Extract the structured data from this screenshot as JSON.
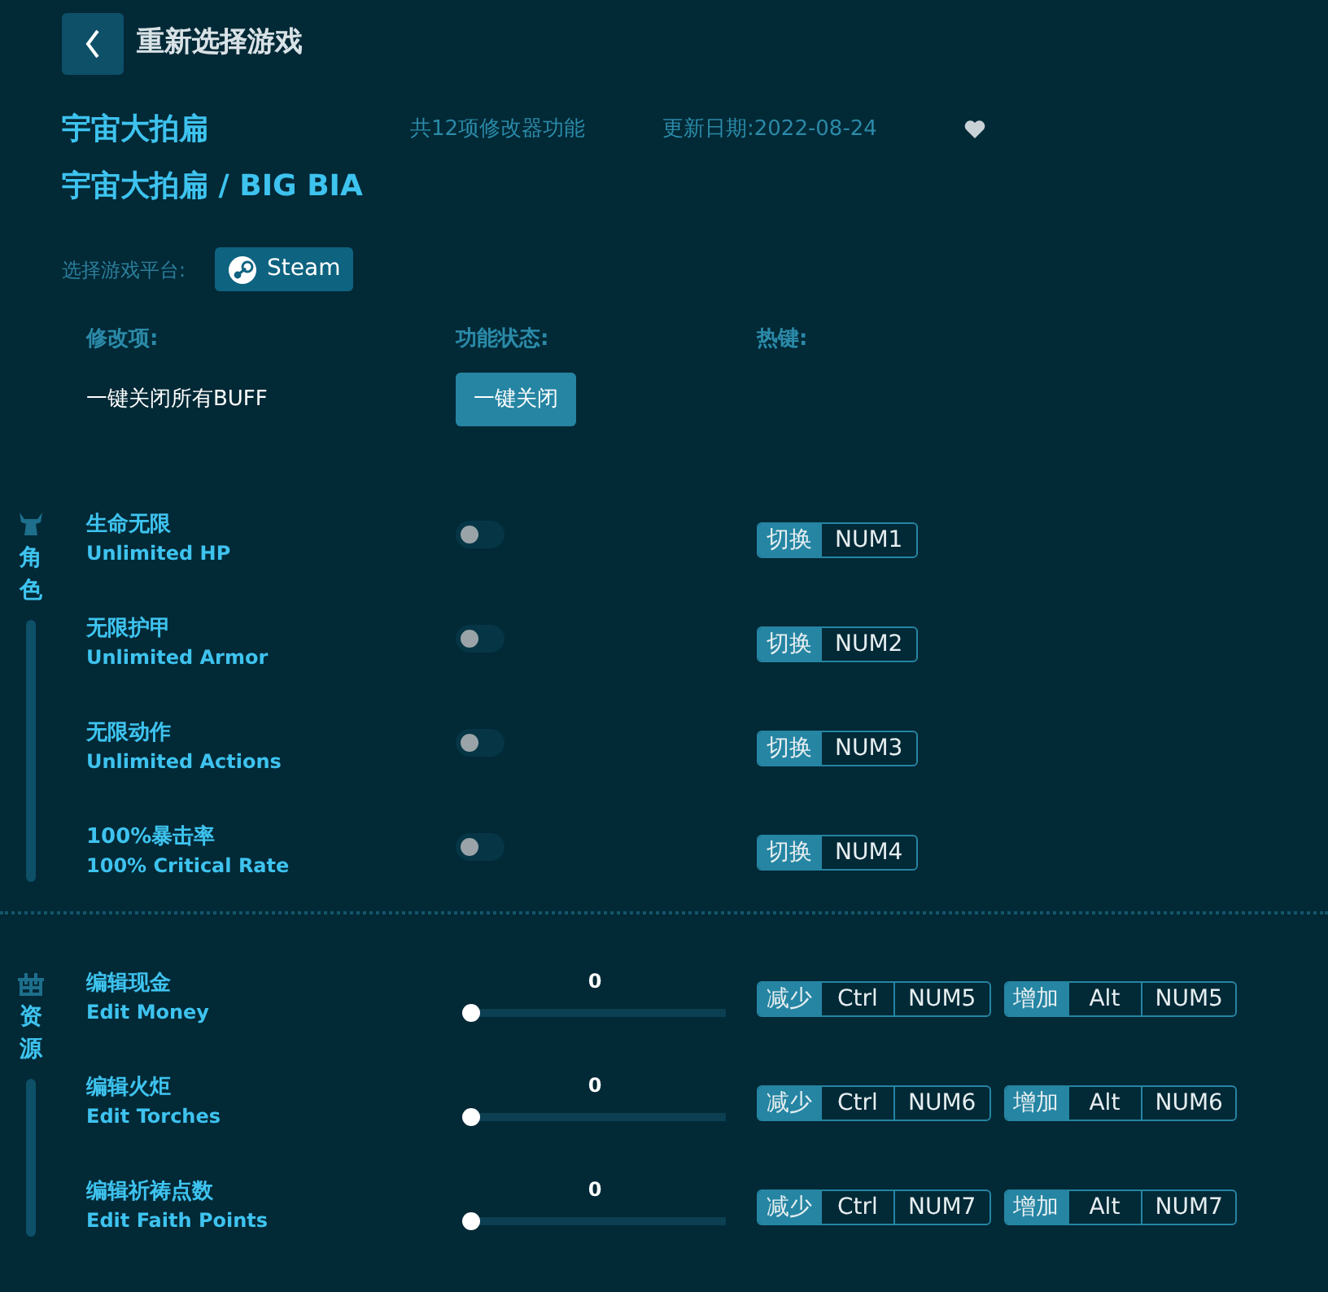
{
  "header": {
    "back_label": "重新选择游戏"
  },
  "game": {
    "title": "宇宙大拍扁",
    "feature_count": "共12项修改器功能",
    "update_date": "更新日期:2022-08-24",
    "favorited": false,
    "subtitle": "宇宙大拍扁 / BIG BIA"
  },
  "platform": {
    "label": "选择游戏平台:",
    "button": "Steam"
  },
  "columns": [
    "修改项:",
    "功能状态:",
    "热键:"
  ],
  "master": {
    "label": "一键关闭所有BUFF",
    "button": "一键关闭"
  },
  "sections": [
    {
      "label": "角色",
      "items": [
        {
          "kind": "toggle",
          "name": "生命无限",
          "name_en": "Unlimited HP",
          "on": false,
          "hotkeys": [
            {
              "action": "切换",
              "keys": [
                "NUM1"
              ]
            }
          ]
        },
        {
          "kind": "toggle",
          "name": "无限护甲",
          "name_en": "Unlimited Armor",
          "on": false,
          "hotkeys": [
            {
              "action": "切换",
              "keys": [
                "NUM2"
              ]
            }
          ]
        },
        {
          "kind": "toggle",
          "name": "无限动作",
          "name_en": "Unlimited Actions",
          "on": false,
          "hotkeys": [
            {
              "action": "切换",
              "keys": [
                "NUM3"
              ]
            }
          ]
        },
        {
          "kind": "toggle",
          "name": "100%暴击率",
          "name_en": "100% Critical Rate",
          "on": false,
          "hotkeys": [
            {
              "action": "切换",
              "keys": [
                "NUM4"
              ]
            }
          ]
        }
      ]
    },
    {
      "label": "资源",
      "items": [
        {
          "kind": "slider",
          "name": "编辑现金",
          "name_en": "Edit Money",
          "value": "0",
          "level": 0,
          "hotkeys": [
            {
              "action": "减少",
              "keys": [
                "Ctrl",
                "NUM5"
              ]
            },
            {
              "action": "增加",
              "keys": [
                "Alt",
                "NUM5"
              ]
            }
          ]
        },
        {
          "kind": "slider",
          "name": "编辑火炬",
          "name_en": "Edit Torches",
          "value": "0",
          "level": 0,
          "hotkeys": [
            {
              "action": "减少",
              "keys": [
                "Ctrl",
                "NUM6"
              ]
            },
            {
              "action": "增加",
              "keys": [
                "Alt",
                "NUM6"
              ]
            }
          ]
        },
        {
          "kind": "slider",
          "name": "编辑祈祷点数",
          "name_en": "Edit Faith Points",
          "value": "0",
          "level": 0,
          "hotkeys": [
            {
              "action": "减少",
              "keys": [
                "Ctrl",
                "NUM7"
              ]
            },
            {
              "action": "增加",
              "keys": [
                "Alt",
                "NUM7"
              ]
            }
          ]
        }
      ]
    }
  ]
}
